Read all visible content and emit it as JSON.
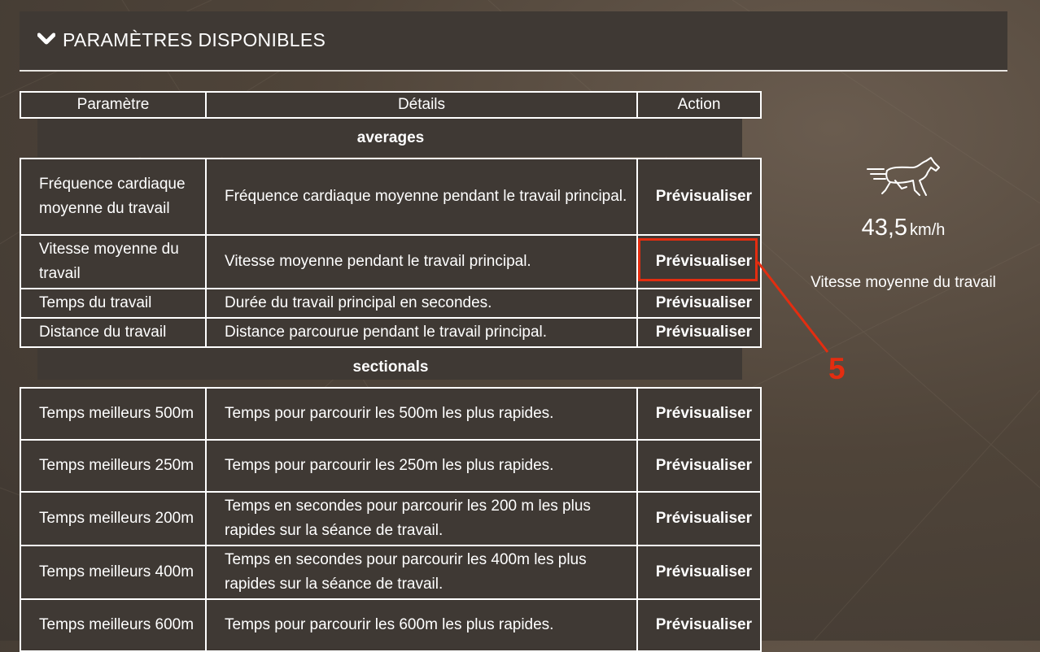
{
  "panel": {
    "title": "PARAMÈTRES DISPONIBLES"
  },
  "table": {
    "headers": [
      "Paramètre",
      "Détails",
      "Action"
    ],
    "groups": [
      {
        "name": "averages",
        "rows": [
          {
            "param": "Fréquence cardiaque moyenne du travail",
            "detail": "Fréquence cardiaque moyenne pendant le travail principal.",
            "action": "Prévisualiser"
          },
          {
            "param": "Vitesse moyenne du travail",
            "detail": "Vitesse moyenne pendant le travail principal.",
            "action": "Prévisualiser"
          },
          {
            "param": "Temps du travail",
            "detail": "Durée du travail principal en secondes.",
            "action": "Prévisualiser"
          },
          {
            "param": "Distance du travail",
            "detail": "Distance parcourue pendant le travail principal.",
            "action": "Prévisualiser"
          }
        ]
      },
      {
        "name": "sectionals",
        "rows": [
          {
            "param": "Temps meilleurs 500m",
            "detail": "Temps pour parcourir les 500m les plus rapides.",
            "action": "Prévisualiser"
          },
          {
            "param": "Temps meilleurs 250m",
            "detail": "Temps pour parcourir les 250m les plus rapides.",
            "action": "Prévisualiser"
          },
          {
            "param": "Temps meilleurs 200m",
            "detail": "Temps en secondes pour parcourir les 200 m les plus rapides sur la séance de travail.",
            "action": "Prévisualiser"
          },
          {
            "param": "Temps meilleurs 400m",
            "detail": "Temps en secondes pour parcourir les 400m les plus rapides sur la séance de travail.",
            "action": "Prévisualiser"
          },
          {
            "param": "Temps meilleurs 600m",
            "detail": "Temps pour parcourir les 600m les plus rapides.",
            "action": "Prévisualiser"
          }
        ]
      }
    ]
  },
  "preview": {
    "value": "43,5",
    "unit": "km/h",
    "label": "Vitesse moyenne du travail",
    "icon": "running-horse-icon"
  },
  "annotation": {
    "number": "5",
    "color": "#e42d10"
  }
}
